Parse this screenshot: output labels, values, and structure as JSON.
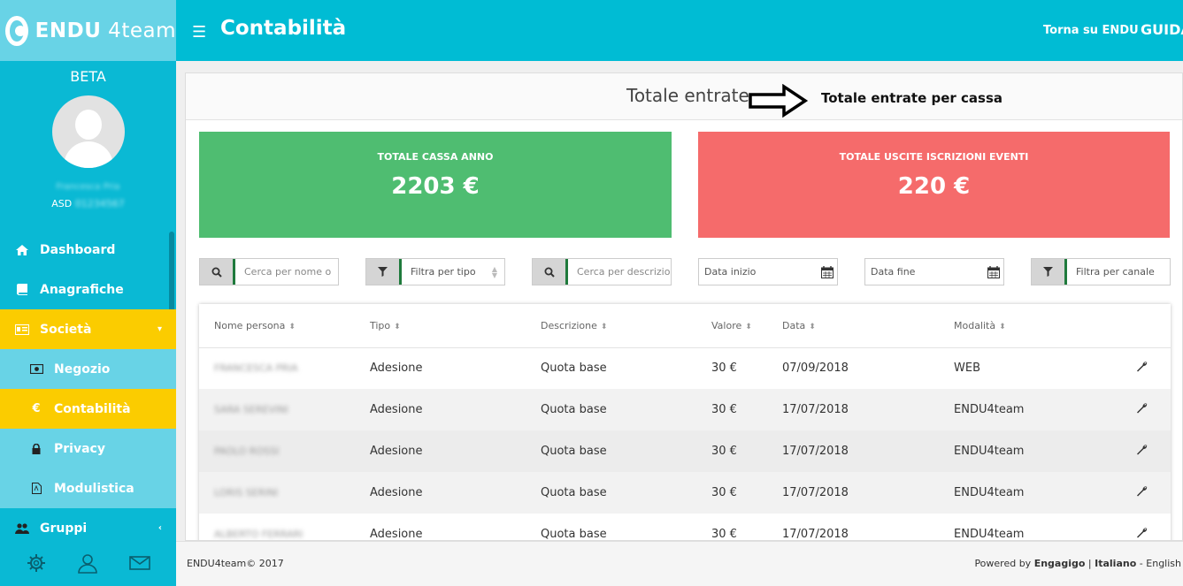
{
  "brand": {
    "name_bold": "ENDU",
    "name_light": " 4team"
  },
  "sidebar": {
    "beta": "BETA",
    "user_name": "Francesca Pria",
    "user_org_prefix": "ASD",
    "user_org_name": "01234567",
    "items": [
      {
        "label": "Dashboard",
        "icon": "home-icon"
      },
      {
        "label": "Anagrafiche",
        "icon": "book-icon"
      },
      {
        "label": "Società",
        "icon": "id-card-icon"
      },
      {
        "label": "Negozio",
        "icon": "money-icon"
      },
      {
        "label": "Contabilità",
        "icon": "euro-icon"
      },
      {
        "label": "Privacy",
        "icon": "lock-icon"
      },
      {
        "label": "Modulistica",
        "icon": "pdf-icon"
      },
      {
        "label": "Gruppi",
        "icon": "users-icon"
      }
    ],
    "footer_icons": [
      "gear-icon",
      "user-icon",
      "mail-icon"
    ]
  },
  "header": {
    "title": "Contabilità",
    "back_link": "Torna su ENDU",
    "guide_link": "GUIDA"
  },
  "main": {
    "section_title": "Totale entrate",
    "annotation": "Totale entrate per cassa",
    "stats": [
      {
        "label": "TOTALE CASSA ANNO",
        "value": "2203 €",
        "color": "#4fbd71"
      },
      {
        "label": "TOTALE USCITE ISCRIZIONI EVENTI",
        "value": "220 €",
        "color": "#f56b6b"
      }
    ],
    "filters": {
      "search_name": "Cerca per nome o",
      "filter_type": "Filtra per tipo",
      "search_desc": "Cerca per descrizione",
      "date_start": "Data inizio",
      "date_end": "Data fine",
      "filter_channel": "Filtra per canale"
    },
    "table": {
      "headers": [
        "Nome persona",
        "Tipo",
        "Descrizione",
        "Valore",
        "Data",
        "Modalità"
      ],
      "rows": [
        {
          "name": "FRANCESCA PRIA",
          "type": "Adesione",
          "desc": "Quota base",
          "value": "30 €",
          "date": "07/09/2018",
          "mode": "WEB"
        },
        {
          "name": "SARA SEREVINI",
          "type": "Adesione",
          "desc": "Quota base",
          "value": "30 €",
          "date": "17/07/2018",
          "mode": "ENDU4team"
        },
        {
          "name": "PAOLO ROSSI",
          "type": "Adesione",
          "desc": "Quota base",
          "value": "30 €",
          "date": "17/07/2018",
          "mode": "ENDU4team"
        },
        {
          "name": "LORIS SERINI",
          "type": "Adesione",
          "desc": "Quota base",
          "value": "30 €",
          "date": "17/07/2018",
          "mode": "ENDU4team"
        },
        {
          "name": "ALBERTO FERRARI",
          "type": "Adesione",
          "desc": "Quota base",
          "value": "30 €",
          "date": "17/07/2018",
          "mode": "ENDU4team"
        }
      ]
    }
  },
  "footer": {
    "copyright": "ENDU4team© 2017",
    "powered_by": "Powered by",
    "powered_name": "Engagigo",
    "lang_sep": "|",
    "lang_it": "Italiano",
    "lang_dash": "-",
    "lang_en": "English"
  }
}
